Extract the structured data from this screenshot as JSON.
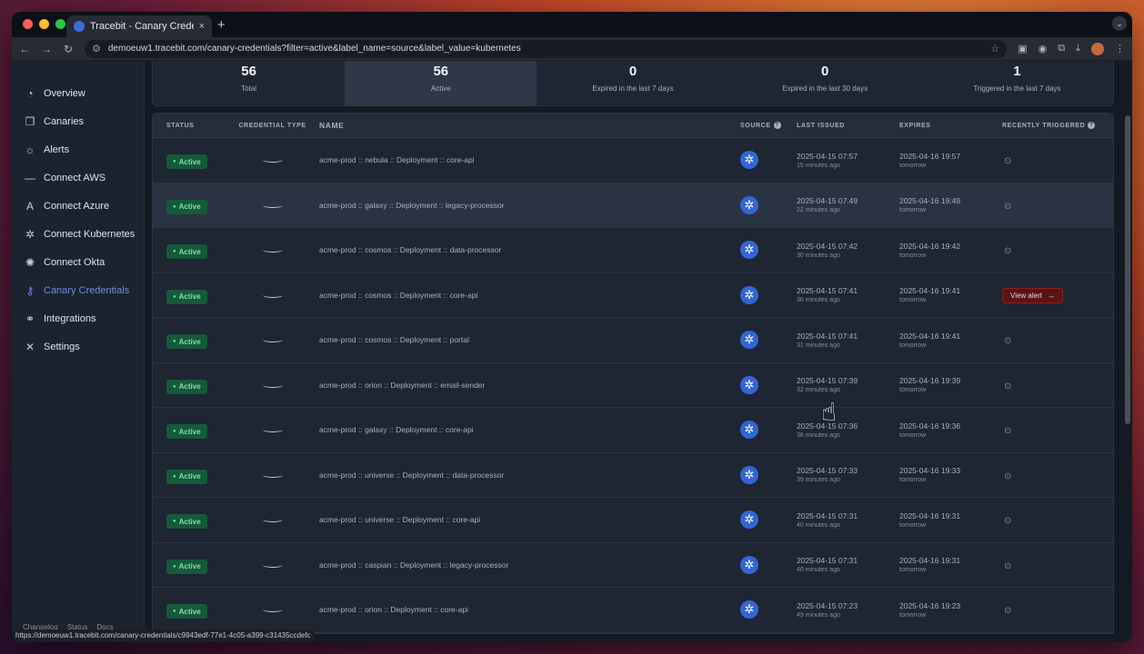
{
  "browser": {
    "tab_title": "Tracebit - Canary Credentials",
    "tab_close": "×",
    "new_tab": "+",
    "url": "demoeuw1.tracebit.com/canary-credentials?filter=active&label_name=source&label_value=kubernetes",
    "status_link": "https://demoeuw1.tracebit.com/canary-credentials/c9943edf-77e1-4c05-a399-c31435ccdefc"
  },
  "sidebar": {
    "items": [
      {
        "label": "Overview",
        "icon": "overview-icon",
        "glyph": "◔"
      },
      {
        "label": "Canaries",
        "icon": "canaries-icon",
        "glyph": "❐"
      },
      {
        "label": "Alerts",
        "icon": "alert-icon",
        "glyph": "☼"
      },
      {
        "label": "Connect AWS",
        "icon": "aws-icon",
        "glyph": "—"
      },
      {
        "label": "Connect Azure",
        "icon": "azure-icon",
        "glyph": "A"
      },
      {
        "label": "Connect Kubernetes",
        "icon": "kubernetes-icon",
        "glyph": "✲"
      },
      {
        "label": "Connect Okta",
        "icon": "okta-icon",
        "glyph": "✺"
      },
      {
        "label": "Canary Credentials",
        "icon": "key-icon",
        "glyph": "⚷"
      },
      {
        "label": "Integrations",
        "icon": "link-icon",
        "glyph": "⚭"
      },
      {
        "label": "Settings",
        "icon": "settings-icon",
        "glyph": "✕"
      }
    ],
    "active_index": 7,
    "footer": [
      "Changelog",
      "Status",
      "Docs"
    ]
  },
  "stats": [
    {
      "value": "56",
      "label": "Total"
    },
    {
      "value": "56",
      "label": "Active"
    },
    {
      "value": "0",
      "label": "Expired in the last 7 days"
    },
    {
      "value": "0",
      "label": "Expired in the last 30 days"
    },
    {
      "value": "1",
      "label": "Triggered in the last 7 days"
    }
  ],
  "table": {
    "headers": {
      "status": "Status",
      "type": "Credential Type",
      "name": "Name",
      "source": "Source",
      "issued": "Last Issued",
      "expires": "Expires",
      "triggered": "Recently Triggered"
    },
    "help_glyph": "?",
    "status_label": "Active",
    "view_alert_label": "View alert",
    "rows": [
      {
        "name": "acme-prod :: nebula :: Deployment :: core-api",
        "issued": "2025-04-15 07:57",
        "issued_ago": "15 minutes ago",
        "expires": "2025-04-16 19:57",
        "expires_rel": "tomorrow",
        "triggered": false
      },
      {
        "name": "acme-prod :: galaxy :: Deployment :: legacy-processor",
        "issued": "2025-04-15 07:49",
        "issued_ago": "22 minutes ago",
        "expires": "2025-04-16 19:49",
        "expires_rel": "tomorrow",
        "triggered": false
      },
      {
        "name": "acme-prod :: cosmos :: Deployment :: data-processor",
        "issued": "2025-04-15 07:42",
        "issued_ago": "30 minutes ago",
        "expires": "2025-04-16 19:42",
        "expires_rel": "tomorrow",
        "triggered": false
      },
      {
        "name": "acme-prod :: cosmos :: Deployment :: core-api",
        "issued": "2025-04-15 07:41",
        "issued_ago": "30 minutes ago",
        "expires": "2025-04-16 19:41",
        "expires_rel": "tomorrow",
        "triggered": true
      },
      {
        "name": "acme-prod :: cosmos :: Deployment :: portal",
        "issued": "2025-04-15 07:41",
        "issued_ago": "31 minutes ago",
        "expires": "2025-04-16 19:41",
        "expires_rel": "tomorrow",
        "triggered": false
      },
      {
        "name": "acme-prod :: orion :: Deployment :: email-sender",
        "issued": "2025-04-15 07:39",
        "issued_ago": "32 minutes ago",
        "expires": "2025-04-16 19:39",
        "expires_rel": "tomorrow",
        "triggered": false
      },
      {
        "name": "acme-prod :: galaxy :: Deployment :: core-api",
        "issued": "2025-04-15 07:36",
        "issued_ago": "36 minutes ago",
        "expires": "2025-04-16 19:36",
        "expires_rel": "tomorrow",
        "triggered": false
      },
      {
        "name": "acme-prod :: universe :: Deployment :: data-processor",
        "issued": "2025-04-15 07:33",
        "issued_ago": "39 minutes ago",
        "expires": "2025-04-16 19:33",
        "expires_rel": "tomorrow",
        "triggered": false
      },
      {
        "name": "acme-prod :: universe :: Deployment :: core-api",
        "issued": "2025-04-15 07:31",
        "issued_ago": "40 minutes ago",
        "expires": "2025-04-16 19:31",
        "expires_rel": "tomorrow",
        "triggered": false
      },
      {
        "name": "acme-prod :: caspian :: Deployment :: legacy-processor",
        "issued": "2025-04-15 07:31",
        "issued_ago": "40 minutes ago",
        "expires": "2025-04-16 19:31",
        "expires_rel": "tomorrow",
        "triggered": false
      },
      {
        "name": "acme-prod :: orion :: Deployment :: core-api",
        "issued": "2025-04-15 07:23",
        "issued_ago": "49 minutes ago",
        "expires": "2025-04-16 19:23",
        "expires_rel": "tomorrow",
        "triggered": false
      }
    ],
    "highlighted_row": 1
  },
  "colors": {
    "accent": "#6f8fd8",
    "active_badge_bg": "#155a3a",
    "active_badge_text": "#7fe0a8",
    "alert_button_bg": "#5a1416",
    "kubernetes_blue": "#3266d6"
  }
}
